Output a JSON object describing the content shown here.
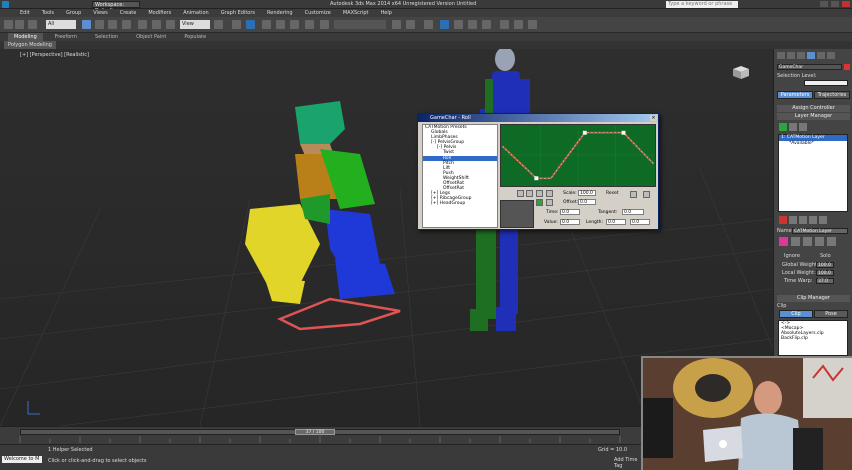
{
  "window": {
    "title": "Autodesk 3ds Max 2014 x64    Unregistered Version    Untitled",
    "workspace": "Workspace: Default",
    "search_placeholder": "Type a keyword or phrase"
  },
  "menu": [
    "Edit",
    "Tools",
    "Group",
    "Views",
    "Create",
    "Modifiers",
    "Animation",
    "Graph Editors",
    "Rendering",
    "Customize",
    "MAXScript",
    "Help"
  ],
  "toolbar": {
    "filter": "All",
    "view": "View"
  },
  "ribbon": {
    "tabs": [
      "Modeling",
      "Freeform",
      "Selection",
      "Object Paint",
      "Populate"
    ],
    "active_tab": "Modeling",
    "sub_label": "Polygon Modeling"
  },
  "viewport": {
    "label": "[+] [Perspective] [Realistic]"
  },
  "dialog": {
    "title": "GameChar - Roll",
    "tree": [
      {
        "text": "CATMotion Presets",
        "indent": 0
      },
      {
        "text": "Globals",
        "indent": 1
      },
      {
        "text": "LimbPhases",
        "indent": 1
      },
      {
        "text": "[-] PelvisGroup",
        "indent": 1
      },
      {
        "text": "[-] Pelvis",
        "indent": 2
      },
      {
        "text": "Twist",
        "indent": 3
      },
      {
        "text": "Roll",
        "indent": 3,
        "selected": true
      },
      {
        "text": "Pitch",
        "indent": 3
      },
      {
        "text": "Lift",
        "indent": 3
      },
      {
        "text": "Push",
        "indent": 3
      },
      {
        "text": "WeightShift",
        "indent": 3
      },
      {
        "text": "OffsetRot",
        "indent": 3
      },
      {
        "text": "OffsetRot",
        "indent": 3
      },
      {
        "text": "[+] Legs",
        "indent": 1
      },
      {
        "text": "[+] RibcageGroup",
        "indent": 1
      },
      {
        "text": "[+] HeadGroup",
        "indent": 1
      }
    ],
    "scale_label": "Scale:",
    "scale_value": "100.0",
    "reset_label": "Reset",
    "offset_label": "Offset:",
    "offset_value": "0.0",
    "time_label": "Time:",
    "time_value": "0.0",
    "tangent_label": "Tangent:",
    "tangent_value": "0.0",
    "value_label": "Value:",
    "value_value": "0.0",
    "length_label": "Length:",
    "length_value": "0.0",
    "length_value2": "0.0"
  },
  "command_panel": {
    "object_name": "GameChar",
    "selection_level": "Selection Level:",
    "tab1": "Parameters",
    "tab2": "Trajectories",
    "assign_controller": "Assign Controller",
    "layer_manager": "Layer Manager",
    "layers": [
      "1: CATMotion Layer",
      "*Available*"
    ],
    "name_label": "Name:",
    "name_value": "CATMotion Layer",
    "ignore_label": "Ignore",
    "solo_label": "Solo",
    "global_weight_label": "Global Weight:",
    "global_weight_value": "100.0",
    "local_weight_label": "Local Weight:",
    "local_weight_value": "100.0",
    "time_warp_label": "Time Warp:",
    "time_warp_value": "37.0",
    "clip_manager": "Clip Manager",
    "clip_label": "Clip",
    "clip_tab1": "Clip",
    "clip_tab2": "Pose",
    "clip_files": [
      "<->",
      "<Mocap>",
      "AbsoluteLayers.clp",
      "BackFlip.clp"
    ]
  },
  "timeline": {
    "frame": "37 / 100"
  },
  "status": {
    "selected": "1 Helper Selected",
    "prompt": "Click or click-and-drag to select objects",
    "maxscript": "Welcome to M",
    "grid": "Grid = 10.0",
    "add_time_tag": "Add Time Tag"
  }
}
